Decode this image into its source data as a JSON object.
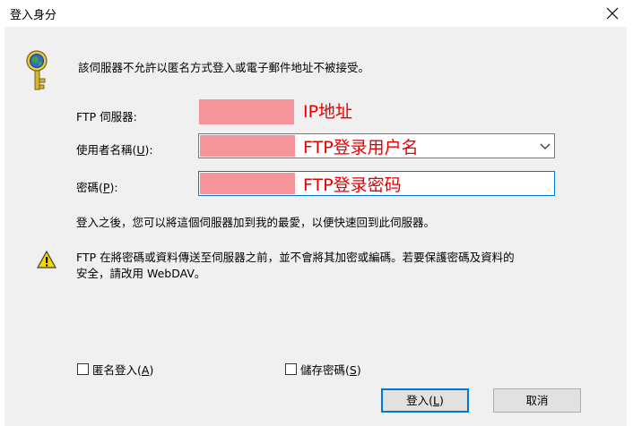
{
  "window": {
    "title": "登入身分",
    "close_icon": "close-icon"
  },
  "message": "該伺服器不允許以匿名方式登入或電子郵件地址不被接受。",
  "server": {
    "label": "FTP 伺服器:",
    "annotation": "IP地址"
  },
  "username": {
    "label_pre": "使用者名稱(",
    "label_key": "U",
    "label_post": "):",
    "annotation": "FTP登录用户名"
  },
  "password": {
    "label_pre": "密碼(",
    "label_key": "P",
    "label_post": "):",
    "annotation": "FTP登录密码"
  },
  "info_text": "登入之後，您可以將這個伺服器加到我的最愛，以便快速回到此伺服器。",
  "warning": {
    "icon": "warning-icon",
    "line1": "FTP 在將密碼或資料傳送至伺服器之前，並不會將其加密或編碼。若要保護密碼及資料的",
    "line2": "安全，請改用 WebDAV。"
  },
  "anonymous_checkbox": {
    "label_pre": "匿名登入(",
    "label_key": "A",
    "label_post": ")",
    "checked": false
  },
  "save_password_checkbox": {
    "label_pre": "儲存密碼(",
    "label_key": "S",
    "label_post": ")",
    "checked": false
  },
  "buttons": {
    "login_pre": "登入(",
    "login_key": "L",
    "login_post": ")",
    "cancel": "取消"
  },
  "colors": {
    "redaction": "#f5949a",
    "annotation": "#e60000",
    "focus_border": "#0078d7"
  }
}
